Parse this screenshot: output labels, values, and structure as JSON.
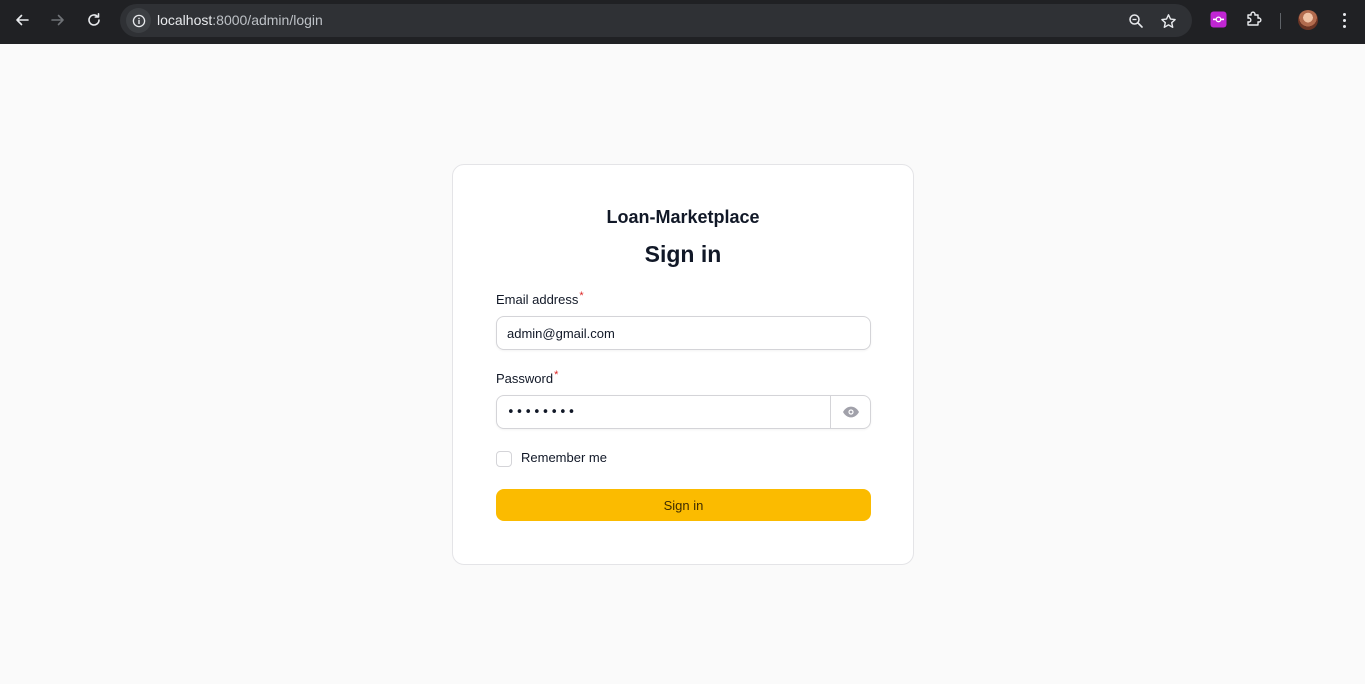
{
  "browser": {
    "url_host": "localhost",
    "url_rest": ":8000/admin/login",
    "icons": {
      "back": "back-arrow-icon",
      "forward": "forward-arrow-icon",
      "reload": "reload-icon",
      "site_info": "info-icon",
      "zoom": "zoom-icon",
      "bookmark": "star-icon",
      "extension_app": "extension-app-icon",
      "extensions": "puzzle-icon",
      "profile": "avatar",
      "menu": "kebab-menu-icon"
    }
  },
  "login": {
    "brand": "Loan-Marketplace",
    "title": "Sign in",
    "email_label": "Email address",
    "required_mark": "*",
    "email_value": "admin@gmail.com",
    "password_label": "Password",
    "password_value": "••••••••",
    "remember_label": "Remember me",
    "submit_label": "Sign in"
  },
  "colors": {
    "page_bg": "#fafafa",
    "accent": "#fbbb00",
    "required": "#dc2626",
    "chrome_bg": "#202124"
  }
}
